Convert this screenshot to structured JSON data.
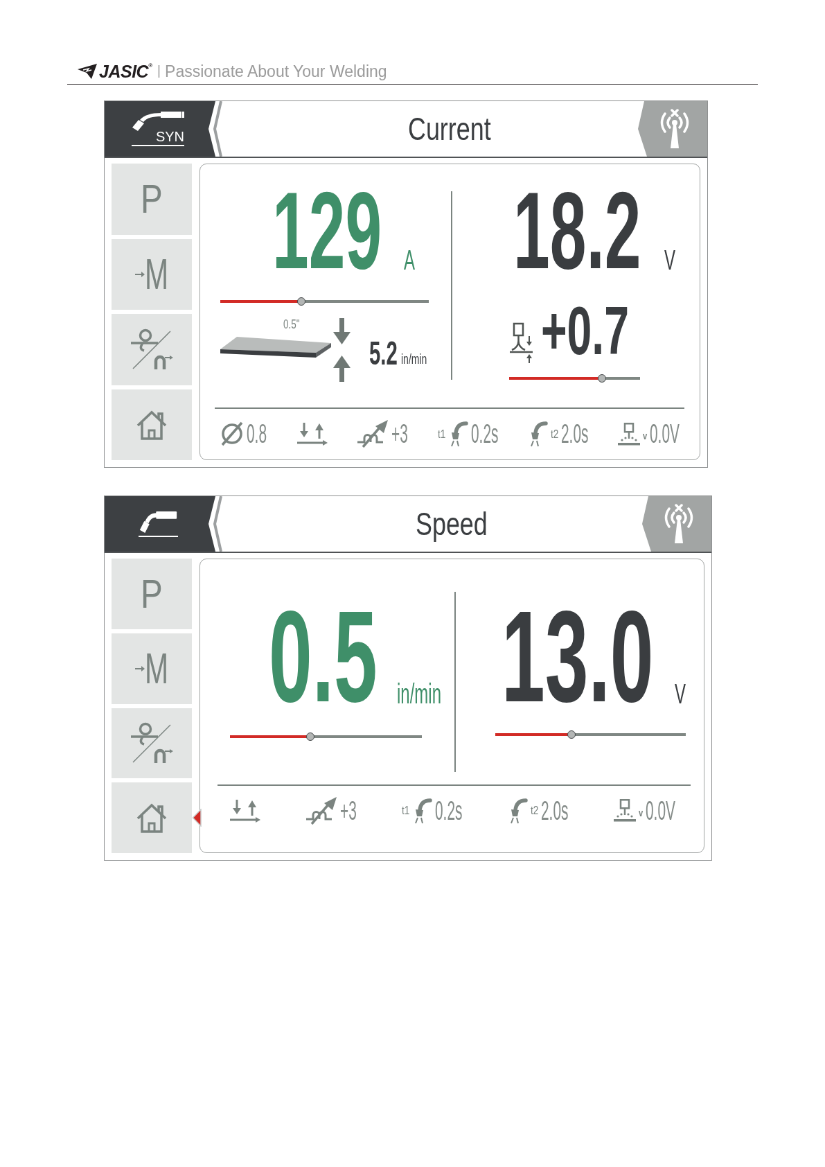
{
  "header": {
    "brand": "JASIC$^{®}$",
    "tagline": "Passionate About Your Welding"
  },
  "screens": [
    {
      "mode_label": "SYN",
      "title": "Current",
      "sidebar": [
        {
          "kind": "letter",
          "label": "P",
          "selected": false
        },
        {
          "kind": "arrow_letter",
          "label": "M",
          "selected": false
        },
        {
          "kind": "feed",
          "selected": false
        },
        {
          "kind": "home",
          "selected": false
        }
      ],
      "readouts": [
        {
          "value": "129",
          "unit": "A",
          "selected": true,
          "level": 0.39,
          "plate": {
            "thickness": "0.5\"",
            "speed": "5.2",
            "speed_unit": "in/min"
          }
        },
        {
          "value": "18.2",
          "unit": "V",
          "selected": false,
          "trim": {
            "value": "+0.7",
            "level": 0.71
          }
        }
      ],
      "status": [
        {
          "kind": "diameter",
          "value": "0.8"
        },
        {
          "kind": "trigger"
        },
        {
          "kind": "inductance",
          "value": "+3"
        },
        {
          "kind": "preflow",
          "tag": "t1",
          "value": "0.2s"
        },
        {
          "kind": "postflow",
          "tag": "t2",
          "value": "2.0s"
        },
        {
          "kind": "burnback",
          "tag": "v",
          "value": "0.0V"
        }
      ]
    },
    {
      "title": "Speed",
      "sidebar": [
        {
          "kind": "letter",
          "label": "P",
          "selected": false
        },
        {
          "kind": "arrow_letter",
          "label": "M",
          "selected": false
        },
        {
          "kind": "feed",
          "selected": false
        },
        {
          "kind": "home",
          "selected": true
        }
      ],
      "readouts": [
        {
          "value": "0.5",
          "unit": "in/min",
          "selected": true,
          "level": 0.42
        },
        {
          "value": "13.0",
          "unit": "V",
          "selected": false,
          "level": 0.4
        }
      ],
      "status": [
        {
          "kind": "trigger"
        },
        {
          "kind": "inductance",
          "value": "+3"
        },
        {
          "kind": "preflow",
          "tag": "t1",
          "value": "0.2s"
        },
        {
          "kind": "postflow",
          "tag": "t2",
          "value": "2.0s"
        },
        {
          "kind": "burnback",
          "tag": "v",
          "value": "0.0V"
        }
      ]
    }
  ]
}
